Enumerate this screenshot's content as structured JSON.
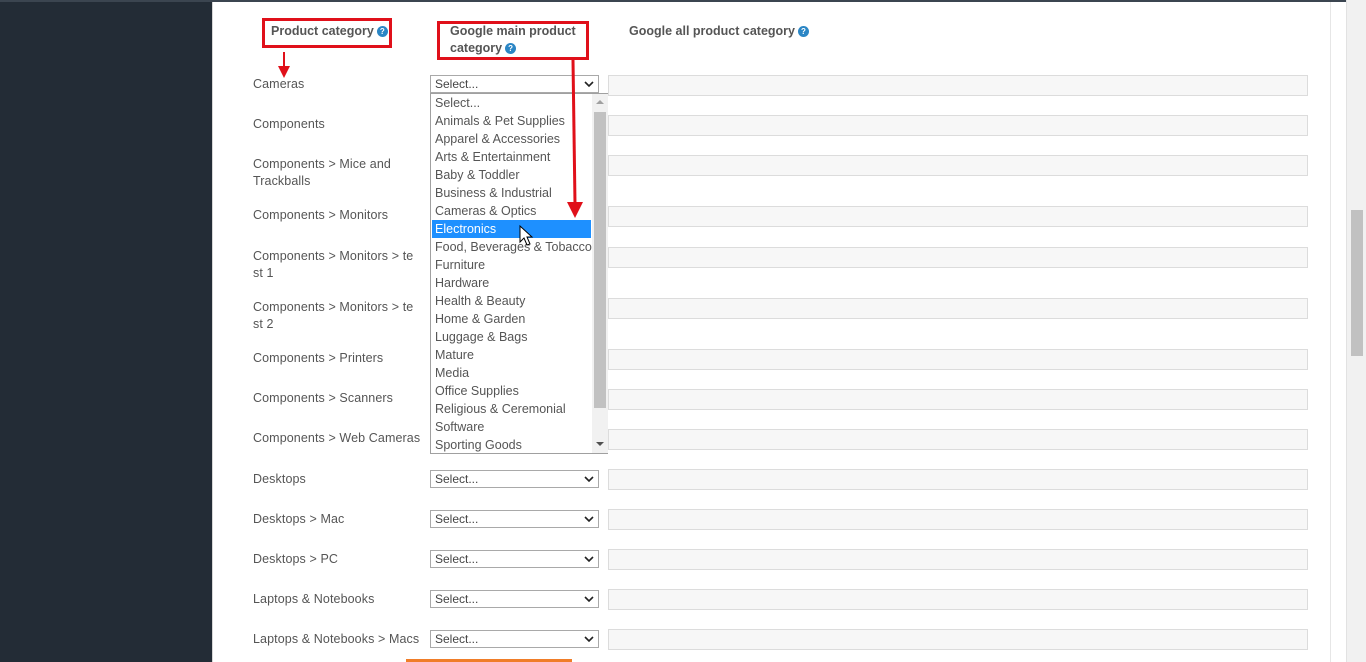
{
  "headers": {
    "product_category": "Product category",
    "google_main": "Google main product category",
    "google_main_line1": "Google main product",
    "google_main_line2": "category",
    "google_all": "Google all product category",
    "help_glyph": "?"
  },
  "rows": [
    {
      "label": "Cameras",
      "select": "Select..."
    },
    {
      "label": "Components",
      "select": ""
    },
    {
      "label": "Components  >  Mice and Trackballs",
      "select": ""
    },
    {
      "label": "Components  >  Monitors",
      "select": ""
    },
    {
      "label": "Components  >  Monitors  >  test 1",
      "select": ""
    },
    {
      "label": "Components  >  Monitors  >  test 2",
      "select": ""
    },
    {
      "label": "Components  >  Printers",
      "select": ""
    },
    {
      "label": "Components  >  Scanners",
      "select": ""
    },
    {
      "label": "Components  >  Web Cameras",
      "select": ""
    },
    {
      "label": "Desktops",
      "select": "Select..."
    },
    {
      "label": "Desktops  >  Mac",
      "select": "Select..."
    },
    {
      "label": "Desktops  >  PC",
      "select": "Select..."
    },
    {
      "label": "Laptops & Notebooks",
      "select": "Select..."
    },
    {
      "label": "Laptops & Notebooks  >  Macs",
      "select": "Select..."
    }
  ],
  "label_lines": {
    "mice_1": "Components  >  Mice and",
    "mice_2": "Trackballs",
    "test1_1": "Components  >  Monitors  >  te",
    "test1_2": "st 1",
    "test2_1": "Components  >  Monitors  >  te",
    "test2_2": "st 2"
  },
  "dropdown": {
    "options": [
      "Select...",
      "Animals & Pet Supplies",
      "Apparel & Accessories",
      "Arts & Entertainment",
      "Baby & Toddler",
      "Business & Industrial",
      "Cameras & Optics",
      "Electronics",
      "Food, Beverages & Tobacco",
      "Furniture",
      "Hardware",
      "Health & Beauty",
      "Home & Garden",
      "Luggage & Bags",
      "Mature",
      "Media",
      "Office Supplies",
      "Religious & Ceremonial",
      "Software",
      "Sporting Goods"
    ],
    "highlighted": "Electronics"
  },
  "colors": {
    "annotation_red": "#e0101a",
    "highlight_blue": "#1e90ff",
    "help_blue": "#2b86c5",
    "sidebar_dark": "#232c36"
  }
}
